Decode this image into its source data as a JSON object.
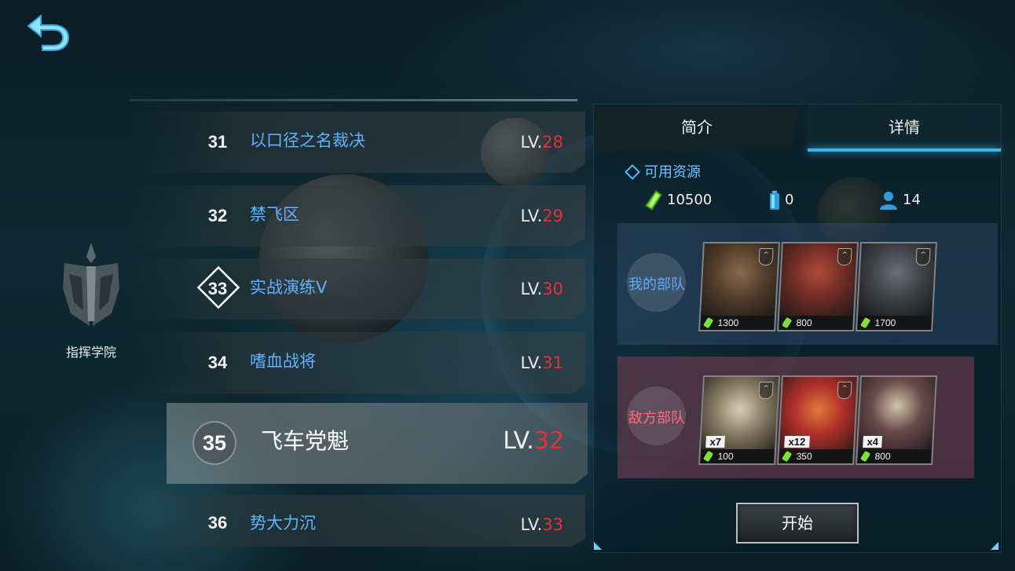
{
  "academy": {
    "label": "指挥学院"
  },
  "levels": [
    {
      "num": "31",
      "title": "以口径之名裁决",
      "lv_prefix": "LV.",
      "lv": "28"
    },
    {
      "num": "32",
      "title": "禁飞区",
      "lv_prefix": "LV.",
      "lv": "29"
    },
    {
      "num": "33",
      "title": "实战演练V",
      "lv_prefix": "LV.",
      "lv": "30"
    },
    {
      "num": "34",
      "title": "嗜血战将",
      "lv_prefix": "LV.",
      "lv": "31"
    },
    {
      "num": "35",
      "title": "飞车党魁",
      "lv_prefix": "LV.",
      "lv": "32"
    },
    {
      "num": "36",
      "title": "势大力沉",
      "lv_prefix": "LV.",
      "lv": "33"
    }
  ],
  "tabs": {
    "intro": "简介",
    "details": "详情"
  },
  "resources": {
    "title": "可用资源",
    "energy": "10500",
    "battery": "0",
    "population": "14"
  },
  "my_army": {
    "label": "我的部队",
    "units": [
      {
        "cost": "1300"
      },
      {
        "cost": "800"
      },
      {
        "cost": "1700"
      }
    ]
  },
  "enemy_army": {
    "label": "敌方部队",
    "units": [
      {
        "count": "x7",
        "cost": "100"
      },
      {
        "count": "x12",
        "cost": "350"
      },
      {
        "count": "x4",
        "cost": "800"
      }
    ]
  },
  "start_button": "开始",
  "colors": {
    "accent": "#36b6f0",
    "level_red": "#e2313c",
    "title_blue": "#5fb2ff"
  }
}
